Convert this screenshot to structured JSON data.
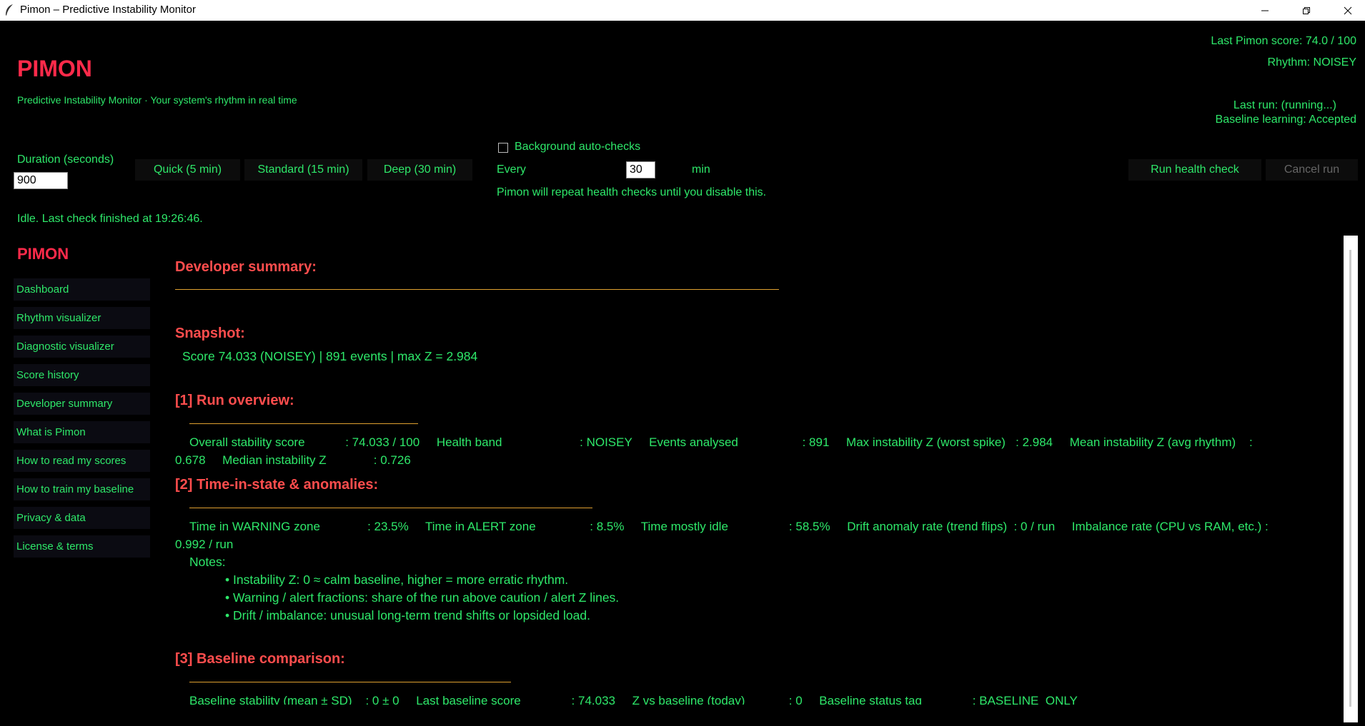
{
  "window": {
    "title": "Pimon – Predictive Instability Monitor",
    "controls": [
      "minimize",
      "maximize",
      "close"
    ]
  },
  "header": {
    "brand": "PIMON",
    "tagline": "Predictive Instability Monitor · Your system's rhythm in real time",
    "last_score": "Last Pimon score: 74.0 / 100",
    "rhythm": "Rhythm: NOISEY",
    "last_run": "Last run: (running...)",
    "baseline_learning": "Baseline learning: Accepted"
  },
  "controls": {
    "duration_label": "Duration (seconds)",
    "duration_value": "900",
    "quick_label": "Quick (5 min)",
    "standard_label": "Standard (15 min)",
    "deep_label": "Deep (30 min)",
    "auto_checks_label": "Background auto-checks",
    "auto_checks_enabled": false,
    "every_label": "Every",
    "every_value": "30",
    "min_label": "min",
    "auto_note": "Pimon will repeat health checks until you disable this.",
    "run_label": "Run health check",
    "cancel_label": "Cancel run"
  },
  "status": "Idle. Last check finished at 19:26:46.",
  "sidebar": {
    "brand": "PIMON",
    "items": [
      {
        "label": "Dashboard"
      },
      {
        "label": "Rhythm visualizer"
      },
      {
        "label": "Diagnostic visualizer"
      },
      {
        "label": "Score history"
      },
      {
        "label": "Developer summary"
      },
      {
        "label": "What is Pimon"
      },
      {
        "label": "How to read my scores"
      },
      {
        "label": "How to train my baseline"
      },
      {
        "label": "Privacy & data"
      },
      {
        "label": "License & terms"
      }
    ]
  },
  "content": {
    "title": "Developer summary:",
    "snapshot_heading": "Snapshot:",
    "snapshot_text": "Score 74.033 (NOISEY) | 891 events | max Z = 2.984",
    "section1": {
      "heading": "[1] Run overview:",
      "line1": "Overall stability score            : 74.033 / 100     Health band                       : NOISEY     Events analysed                   : 891     Max instability Z (worst spike)   : 2.984     Mean instability Z (avg rhythm)    :",
      "line2": "0.678     Median instability Z              : 0.726"
    },
    "section2": {
      "heading": "[2] Time-in-state & anomalies:",
      "line1": "Time in WARNING zone              : 23.5%     Time in ALERT zone                : 8.5%     Time mostly idle                  : 58.5%     Drift anomaly rate (trend flips)  : 0 / run     Imbalance rate (CPU vs RAM, etc.) :",
      "line2": "0.992 / run",
      "notes_label": "Notes:",
      "notes": [
        "• Instability Z: 0 ≈ calm baseline, higher = more erratic rhythm.",
        "• Warning / alert fractions: share of the run above caution / alert Z lines.",
        "• Drift / imbalance: unusual long-term trend shifts or lopsided load."
      ]
    },
    "section3": {
      "heading": "[3] Baseline comparison:",
      "line1": "Baseline stability (mean ± SD)    : 0 ± 0     Last baseline score               : 74.033     Z vs baseline (today)             : 0     Baseline status tag               : BASELINE_ONLY"
    }
  }
}
